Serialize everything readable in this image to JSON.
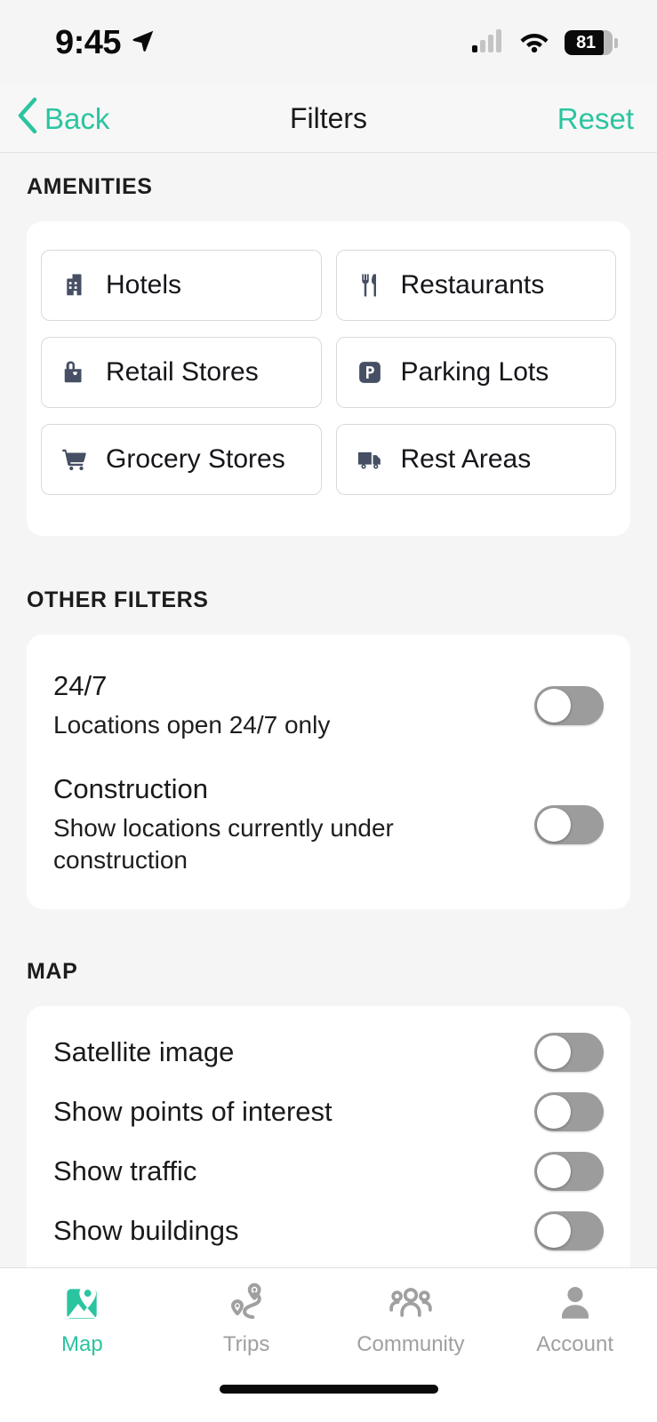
{
  "status_bar": {
    "time": "9:45",
    "location_icon": "location-arrow-icon",
    "cellular_icon": "cellular-bars-icon",
    "wifi_icon": "wifi-icon",
    "battery_level": "81"
  },
  "header": {
    "back_label": "Back",
    "title": "Filters",
    "reset_label": "Reset",
    "accent_color": "#2bc4a0"
  },
  "amenities": {
    "section_label": "AMENITIES",
    "items": [
      {
        "label": "Hotels",
        "icon": "hotel-building-icon",
        "selected": false
      },
      {
        "label": "Restaurants",
        "icon": "fork-knife-icon",
        "selected": false
      },
      {
        "label": "Retail Stores",
        "icon": "shopping-bag-icon",
        "selected": false
      },
      {
        "label": "Parking Lots",
        "icon": "parking-p-icon",
        "selected": false
      },
      {
        "label": "Grocery Stores",
        "icon": "shopping-cart-icon",
        "selected": false
      },
      {
        "label": "Rest Areas",
        "icon": "truck-icon",
        "selected": false
      }
    ]
  },
  "other_filters": {
    "section_label": "OTHER FILTERS",
    "items": [
      {
        "title": "24/7",
        "subtitle": "Locations open 24/7 only",
        "state": "off"
      },
      {
        "title": "Construction",
        "subtitle": "Show locations currently under construction",
        "state": "off"
      }
    ]
  },
  "map_settings": {
    "section_label": "MAP",
    "items": [
      {
        "label": "Satellite image",
        "state": "off"
      },
      {
        "label": "Show points of interest",
        "state": "off"
      },
      {
        "label": "Show traffic",
        "state": "off"
      },
      {
        "label": "Show buildings",
        "state": "off"
      }
    ]
  },
  "tab_bar": {
    "items": [
      {
        "label": "Map",
        "icon": "map-pin-icon",
        "active": true
      },
      {
        "label": "Trips",
        "icon": "route-pins-icon",
        "active": false
      },
      {
        "label": "Community",
        "icon": "people-group-icon",
        "active": false
      },
      {
        "label": "Account",
        "icon": "person-icon",
        "active": false
      }
    ]
  },
  "colors": {
    "accent": "#2bc4a0",
    "icon_slate": "#464f63",
    "toggle_off": "#9c9c9c",
    "page_bg": "#f5f5f5",
    "card_bg": "#ffffff",
    "inactive_tab": "#a0a0a0"
  }
}
